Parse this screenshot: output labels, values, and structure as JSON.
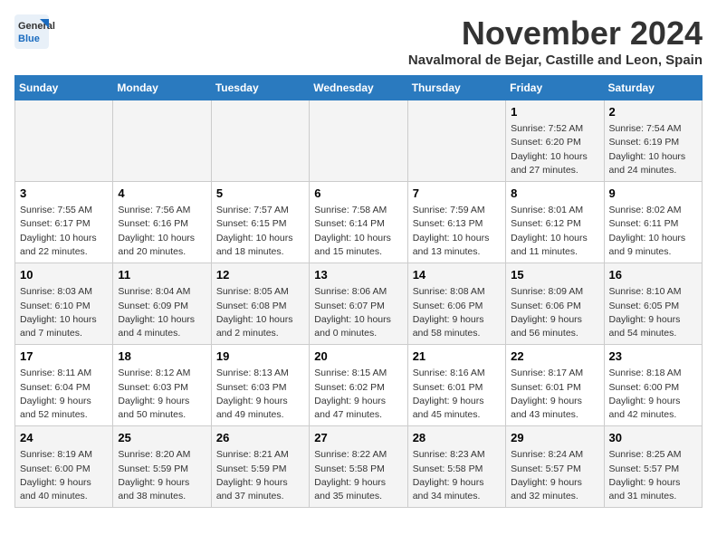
{
  "logo": {
    "name": "General",
    "name2": "Blue"
  },
  "header": {
    "month": "November 2024",
    "location": "Navalmoral de Bejar, Castille and Leon, Spain"
  },
  "weekdays": [
    "Sunday",
    "Monday",
    "Tuesday",
    "Wednesday",
    "Thursday",
    "Friday",
    "Saturday"
  ],
  "weeks": [
    {
      "days": [
        {
          "num": "",
          "info": ""
        },
        {
          "num": "",
          "info": ""
        },
        {
          "num": "",
          "info": ""
        },
        {
          "num": "",
          "info": ""
        },
        {
          "num": "",
          "info": ""
        },
        {
          "num": "1",
          "info": "Sunrise: 7:52 AM\nSunset: 6:20 PM\nDaylight: 10 hours and 27 minutes."
        },
        {
          "num": "2",
          "info": "Sunrise: 7:54 AM\nSunset: 6:19 PM\nDaylight: 10 hours and 24 minutes."
        }
      ]
    },
    {
      "days": [
        {
          "num": "3",
          "info": "Sunrise: 7:55 AM\nSunset: 6:17 PM\nDaylight: 10 hours and 22 minutes."
        },
        {
          "num": "4",
          "info": "Sunrise: 7:56 AM\nSunset: 6:16 PM\nDaylight: 10 hours and 20 minutes."
        },
        {
          "num": "5",
          "info": "Sunrise: 7:57 AM\nSunset: 6:15 PM\nDaylight: 10 hours and 18 minutes."
        },
        {
          "num": "6",
          "info": "Sunrise: 7:58 AM\nSunset: 6:14 PM\nDaylight: 10 hours and 15 minutes."
        },
        {
          "num": "7",
          "info": "Sunrise: 7:59 AM\nSunset: 6:13 PM\nDaylight: 10 hours and 13 minutes."
        },
        {
          "num": "8",
          "info": "Sunrise: 8:01 AM\nSunset: 6:12 PM\nDaylight: 10 hours and 11 minutes."
        },
        {
          "num": "9",
          "info": "Sunrise: 8:02 AM\nSunset: 6:11 PM\nDaylight: 10 hours and 9 minutes."
        }
      ]
    },
    {
      "days": [
        {
          "num": "10",
          "info": "Sunrise: 8:03 AM\nSunset: 6:10 PM\nDaylight: 10 hours and 7 minutes."
        },
        {
          "num": "11",
          "info": "Sunrise: 8:04 AM\nSunset: 6:09 PM\nDaylight: 10 hours and 4 minutes."
        },
        {
          "num": "12",
          "info": "Sunrise: 8:05 AM\nSunset: 6:08 PM\nDaylight: 10 hours and 2 minutes."
        },
        {
          "num": "13",
          "info": "Sunrise: 8:06 AM\nSunset: 6:07 PM\nDaylight: 10 hours and 0 minutes."
        },
        {
          "num": "14",
          "info": "Sunrise: 8:08 AM\nSunset: 6:06 PM\nDaylight: 9 hours and 58 minutes."
        },
        {
          "num": "15",
          "info": "Sunrise: 8:09 AM\nSunset: 6:06 PM\nDaylight: 9 hours and 56 minutes."
        },
        {
          "num": "16",
          "info": "Sunrise: 8:10 AM\nSunset: 6:05 PM\nDaylight: 9 hours and 54 minutes."
        }
      ]
    },
    {
      "days": [
        {
          "num": "17",
          "info": "Sunrise: 8:11 AM\nSunset: 6:04 PM\nDaylight: 9 hours and 52 minutes."
        },
        {
          "num": "18",
          "info": "Sunrise: 8:12 AM\nSunset: 6:03 PM\nDaylight: 9 hours and 50 minutes."
        },
        {
          "num": "19",
          "info": "Sunrise: 8:13 AM\nSunset: 6:03 PM\nDaylight: 9 hours and 49 minutes."
        },
        {
          "num": "20",
          "info": "Sunrise: 8:15 AM\nSunset: 6:02 PM\nDaylight: 9 hours and 47 minutes."
        },
        {
          "num": "21",
          "info": "Sunrise: 8:16 AM\nSunset: 6:01 PM\nDaylight: 9 hours and 45 minutes."
        },
        {
          "num": "22",
          "info": "Sunrise: 8:17 AM\nSunset: 6:01 PM\nDaylight: 9 hours and 43 minutes."
        },
        {
          "num": "23",
          "info": "Sunrise: 8:18 AM\nSunset: 6:00 PM\nDaylight: 9 hours and 42 minutes."
        }
      ]
    },
    {
      "days": [
        {
          "num": "24",
          "info": "Sunrise: 8:19 AM\nSunset: 6:00 PM\nDaylight: 9 hours and 40 minutes."
        },
        {
          "num": "25",
          "info": "Sunrise: 8:20 AM\nSunset: 5:59 PM\nDaylight: 9 hours and 38 minutes."
        },
        {
          "num": "26",
          "info": "Sunrise: 8:21 AM\nSunset: 5:59 PM\nDaylight: 9 hours and 37 minutes."
        },
        {
          "num": "27",
          "info": "Sunrise: 8:22 AM\nSunset: 5:58 PM\nDaylight: 9 hours and 35 minutes."
        },
        {
          "num": "28",
          "info": "Sunrise: 8:23 AM\nSunset: 5:58 PM\nDaylight: 9 hours and 34 minutes."
        },
        {
          "num": "29",
          "info": "Sunrise: 8:24 AM\nSunset: 5:57 PM\nDaylight: 9 hours and 32 minutes."
        },
        {
          "num": "30",
          "info": "Sunrise: 8:25 AM\nSunset: 5:57 PM\nDaylight: 9 hours and 31 minutes."
        }
      ]
    }
  ]
}
